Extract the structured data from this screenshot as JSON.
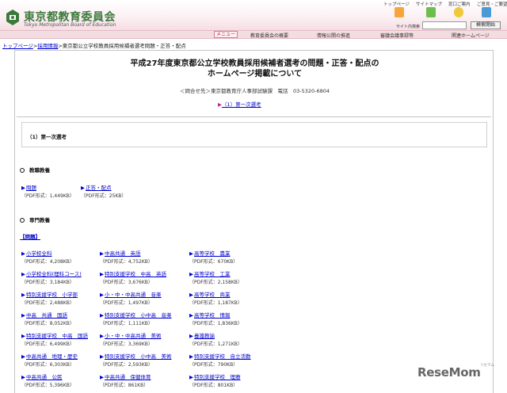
{
  "header": {
    "logo_title": "東京都教育委員会",
    "logo_subtitle": "Tokyo Metropolitan Board of Education",
    "top_links": [
      "トップページ",
      "サイトマップ",
      "窓口ご案内",
      "ご意見・ご要望"
    ],
    "search_label": "サイト内検索",
    "search_placeholder": "",
    "search_button": "検索開始"
  },
  "nav": {
    "menu_button": "メニュー",
    "items": [
      "教育委員会の概要",
      "情報公開の推進",
      "審議会議事録等",
      "関連ホームページ"
    ]
  },
  "breadcrumb": {
    "home": "トップページ",
    "sep1": ">",
    "parent": "採用情報",
    "sep2": ">",
    "current": "東京都公立学校教員採用候補者選考問題・正答・配点"
  },
  "page": {
    "title_line1": "平成27年度東京都公立学校教員採用候補者選考の問題・正答・配点の",
    "title_line2": "ホームページ掲載について",
    "contact": "＜問合せ先＞東京都教育庁人事部試験課　電話　03-5320-6804",
    "anchor_first": "（1）第一次選考",
    "section_box": "（1）第一次選考",
    "general_heading": "教職教養",
    "general_items": [
      {
        "title": "問題",
        "size": "（PDF形式：1,449KB）"
      },
      {
        "title": "正答・配点",
        "size": "（PDF形式：25KB）"
      }
    ],
    "specialty_heading": "専門教養",
    "mondai_label": "【問題】",
    "grid": [
      [
        {
          "title": "小学校全科",
          "size": "（PDF形式：4,208KB）"
        },
        {
          "title": "中高共通　英語",
          "size": "（PDF形式：4,752KB）"
        },
        {
          "title": "高等学校　農業",
          "size": "（PDF形式：670KB）"
        }
      ],
      [
        {
          "title": "小学校全科(理科コース)",
          "size": "（PDF形式：3,184KB）"
        },
        {
          "title": "特別支援学校　中高　英語",
          "size": "（PDF形式：3,676KB）"
        },
        {
          "title": "高等学校　工業",
          "size": "（PDF形式：2,158KB）"
        }
      ],
      [
        {
          "title": "特別支援学校　小学部",
          "size": "（PDF形式：2,488KB）"
        },
        {
          "title": "小・中・中高共通　音楽",
          "size": "（PDF形式：1,497KB）"
        },
        {
          "title": "高等学校　商業",
          "size": "（PDF形式：1,187KB）"
        }
      ],
      [
        {
          "title": "中高　共通　国語",
          "size": "（PDF形式：8,052KB）"
        },
        {
          "title": "特別支援学校　小中高　音楽",
          "size": "（PDF形式：1,111KB）"
        },
        {
          "title": "高等学校　情報",
          "size": "（PDF形式：1,836KB）"
        }
      ],
      [
        {
          "title": "特別支援学校　中高　国語",
          "size": "（PDF形式：6,499KB）"
        },
        {
          "title": "小・中・中高共通　美術",
          "size": "（PDF形式：3,369KB）"
        },
        {
          "title": "養護教諭",
          "size": "（PDF形式：1,271KB）"
        }
      ],
      [
        {
          "title": "中高共通　地理・歴史",
          "size": "（PDF形式：6,303KB）"
        },
        {
          "title": "特別支援学校　小中高　美術",
          "size": "（PDF形式：2,593KB）"
        },
        {
          "title": "特別支援学校　自立活動",
          "size": "（PDF形式：790KB）"
        }
      ],
      [
        {
          "title": "中高共通　公民",
          "size": "（PDF形式：5,396KB）"
        },
        {
          "title": "中高共通　保健体育",
          "size": "（PDF形式：861KB）"
        },
        {
          "title": "特別支援学校　理療",
          "size": "（PDF形式：801KB）"
        }
      ]
    ]
  },
  "watermark": {
    "brand": "ReseMom",
    "small": "リセマム"
  },
  "colors": {
    "link": "#0000cc",
    "accent": "#b02040",
    "logo_green": "#3c7a3c"
  }
}
